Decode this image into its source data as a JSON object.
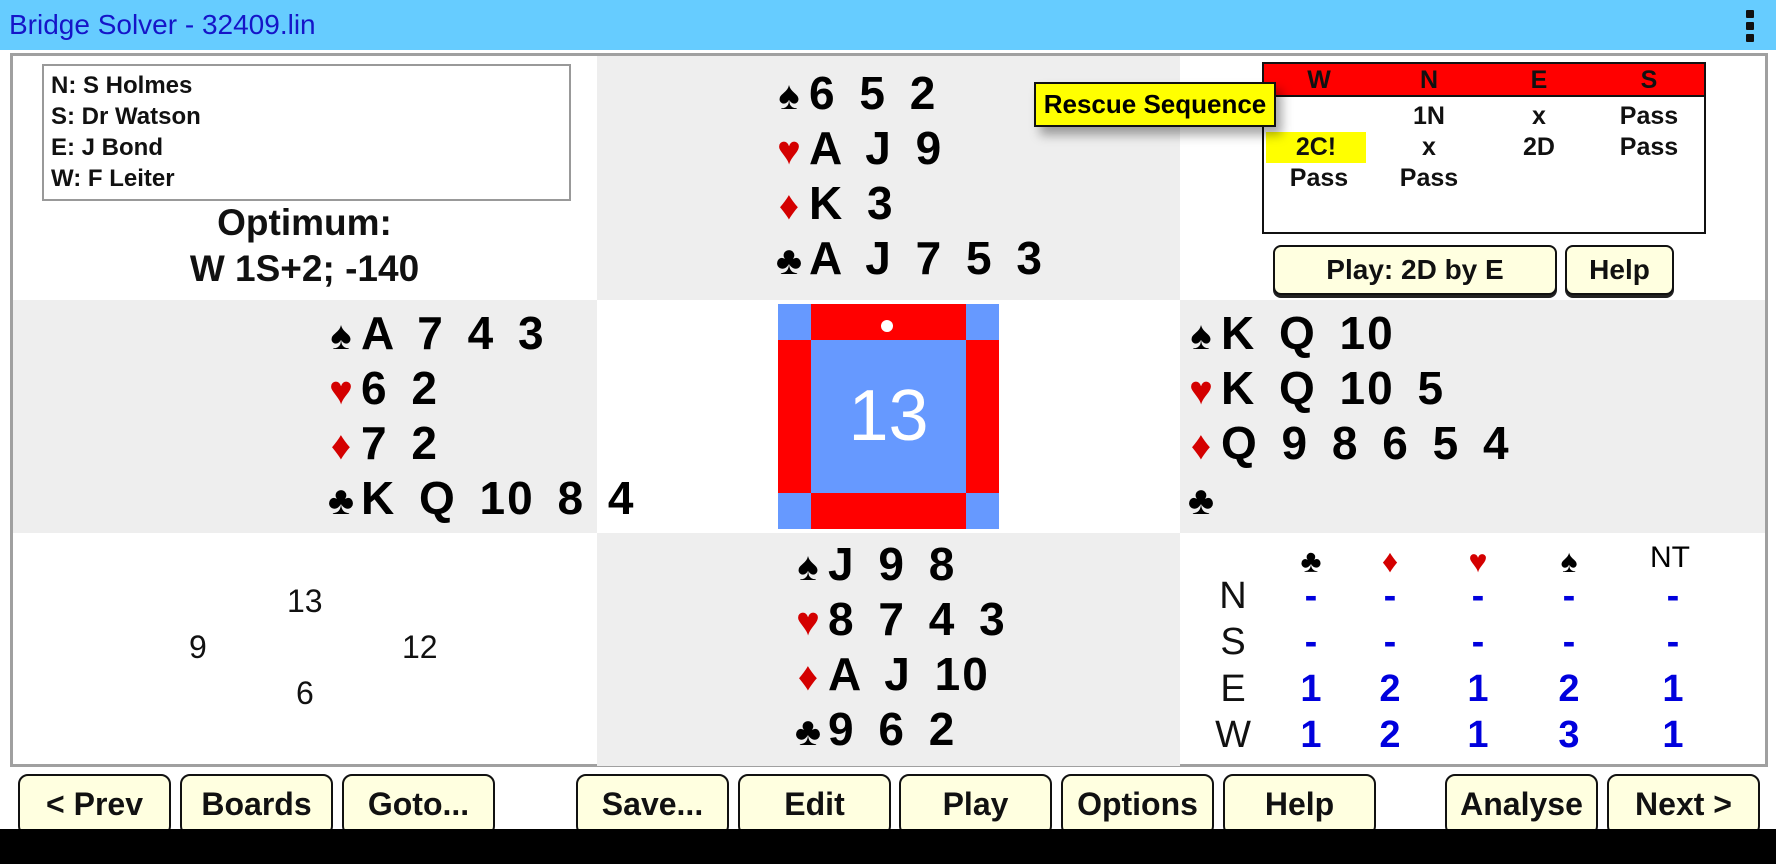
{
  "app": {
    "title": "Bridge Solver - 32409.lin",
    "menu_icon": "overflow-menu-icon"
  },
  "players": {
    "north": "N: S Holmes",
    "south": "S: Dr Watson",
    "east": "E: J Bond",
    "west": "W: F Leiter"
  },
  "optimum": {
    "label": "Optimum:",
    "value": "W 1S+2; -140"
  },
  "suits": {
    "spades": "♠",
    "hearts": "♥",
    "diamonds": "♦",
    "clubs": "♣"
  },
  "hands": {
    "north": {
      "spades": "6 5 2",
      "hearts": "A J 9",
      "diamonds": "K 3",
      "clubs": "A J 7 5 3"
    },
    "west": {
      "spades": "A 7 4 3",
      "hearts": "6 2",
      "diamonds": "7 2",
      "clubs": "K Q 10 8 4"
    },
    "east": {
      "spades": "K Q 10",
      "hearts": "K Q 10 5",
      "diamonds": "Q 9 8 6 5 4",
      "clubs": ""
    },
    "south": {
      "spades": "J 9 8",
      "hearts": "8 7 4 3",
      "diamonds": "A J 10",
      "clubs": "9 6 2"
    }
  },
  "tooltip": "Rescue Sequence",
  "auction": {
    "headers": [
      "W",
      "N",
      "E",
      "S"
    ],
    "rows": [
      [
        "",
        "1N",
        "x",
        "Pass"
      ],
      [
        "2C!",
        "x",
        "2D",
        "Pass"
      ],
      [
        "Pass",
        "Pass",
        "",
        ""
      ]
    ],
    "highlighted": "2C!",
    "colors": {
      "header_bg": "#ff0000",
      "highlight_bg": "#ffff00"
    }
  },
  "contract_button": "Play: 2D by E",
  "help_button_top": "Help",
  "compass": {
    "board_number": "13",
    "dealer_marker": "N",
    "colors": {
      "vulnerable": "#ff0000",
      "non_vulnerable": "#6699ff"
    }
  },
  "hcp": {
    "north": "13",
    "west": "9",
    "east": "12",
    "south": "6"
  },
  "double_dummy": {
    "headers": [
      "♣",
      "♦",
      "♥",
      "♠",
      "NT"
    ],
    "rows": [
      {
        "seat": "N",
        "values": [
          "-",
          "-",
          "-",
          "-",
          "-"
        ]
      },
      {
        "seat": "S",
        "values": [
          "-",
          "-",
          "-",
          "-",
          "-"
        ]
      },
      {
        "seat": "E",
        "values": [
          "1",
          "2",
          "1",
          "2",
          "1"
        ]
      },
      {
        "seat": "W",
        "values": [
          "1",
          "2",
          "1",
          "3",
          "1"
        ]
      }
    ]
  },
  "toolbar": {
    "prev": "< Prev",
    "boards": "Boards",
    "goto": "Goto...",
    "save": "Save...",
    "edit": "Edit",
    "play": "Play",
    "options": "Options",
    "help": "Help",
    "analyse": "Analyse",
    "next": "Next >"
  }
}
